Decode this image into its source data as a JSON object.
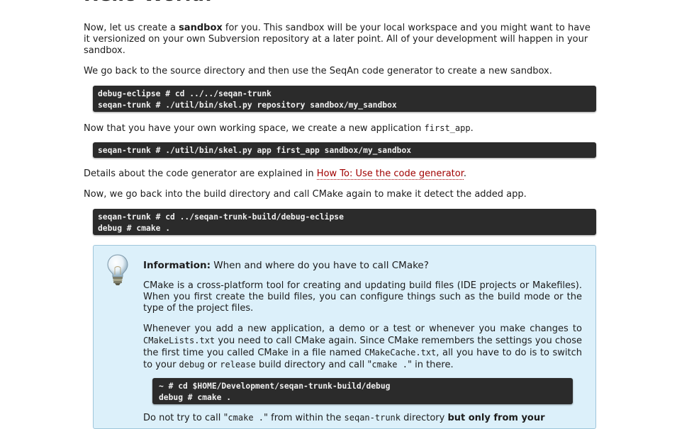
{
  "heading": "Hello World!",
  "p1": {
    "pre": "Now, let us create a ",
    "bold": "sandbox",
    "post": " for you. This sandbox will be your local workspace and you might want to have it versionized on your own Subversion repository at a later point. All of your development will happen in your sandbox."
  },
  "p2": "We go back to the source directory and then use the SeqAn code generator to create a new sandbox.",
  "code1": {
    "line1": "debug-eclipse # cd ../../seqan-trunk",
    "line2": "seqan-trunk # ./util/bin/skel.py repository sandbox/my_sandbox"
  },
  "p3": {
    "text": "Now that you have your own working space, we create a new application ",
    "code": "first_app",
    "end": "."
  },
  "code2": {
    "line1": "seqan-trunk # ./util/bin/skel.py app first_app sandbox/my_sandbox"
  },
  "p4": {
    "text": "Details about the code generator are explained in ",
    "link": "How To: Use the code generator",
    "end": "."
  },
  "p5": "Now, we go back into the build directory and call CMake again to make it detect the added app.",
  "code3": {
    "line1": "seqan-trunk # cd ../seqan-trunk-build/debug-eclipse",
    "line2": "debug # cmake ."
  },
  "info": {
    "label": "Information:",
    "title": " When and where do you have to call CMake?",
    "p1": "CMake is a cross-platform tool for creating and updating build files (IDE projects or Makefiles). When you first create the build files, you can configure things such as the build mode or the type of the project files.",
    "p2": {
      "a": "Whenever you add a new application, a demo or a test or whenever you make changes to ",
      "code1": "CMakeLists.txt",
      "b": " you need to call CMake again. Since CMake remembers the settings you chose the first time you called CMake in a file named ",
      "code2": "CMakeCache.txt",
      "c": ", all you have to do is to switch to your ",
      "code3": "debug",
      "d": " or ",
      "code4": "release",
      "e": " build directory and call \"",
      "code5": "cmake .",
      "f": "\" in there."
    },
    "code": {
      "line1": "~ # cd $HOME/Development/seqan-trunk-build/debug",
      "line2": "debug # cmake ."
    },
    "p3": {
      "a": "Do not try to call \"",
      "code1": "cmake .",
      "b": "\" from within the ",
      "code2": "seqan-trunk",
      "c": " directory ",
      "bold": "but only from your"
    }
  }
}
